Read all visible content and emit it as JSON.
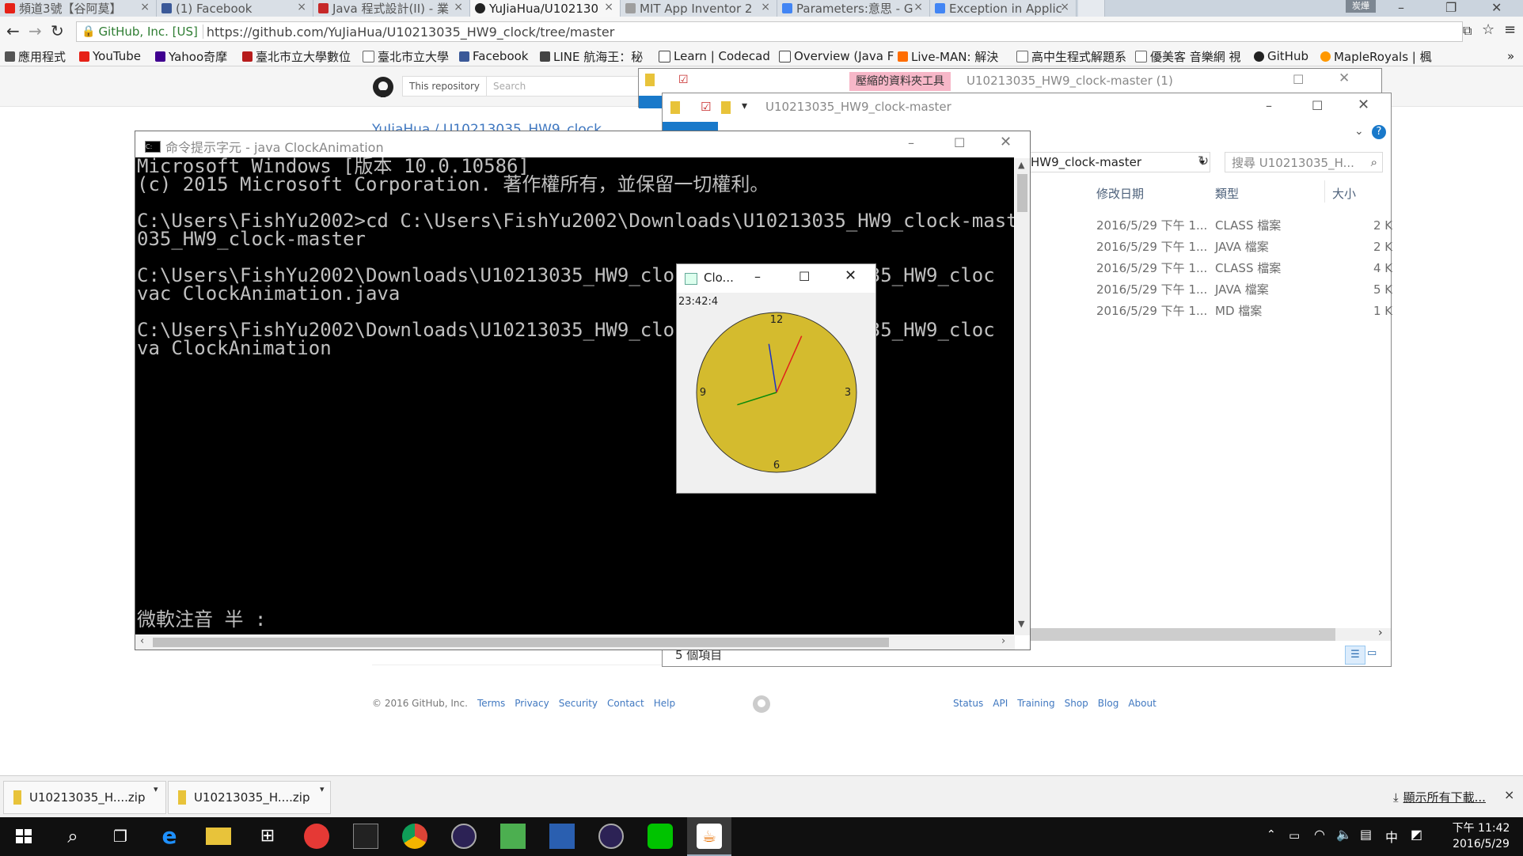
{
  "chrome": {
    "tabs": [
      {
        "label": "頻道3號【谷阿莫】",
        "color": "#e62117"
      },
      {
        "label": "(1) Facebook",
        "color": "#3b5998"
      },
      {
        "label": "Java 程式設計(II) - 業",
        "color": "#c62828"
      },
      {
        "label": "YuJiaHua/U102130",
        "color": "#222222"
      },
      {
        "label": "MIT App Inventor 2",
        "color": "#9e9e9e"
      },
      {
        "label": "Parameters:意思 - G",
        "color": "#4285f4"
      },
      {
        "label": "Exception in Applic",
        "color": "#4285f4"
      }
    ],
    "tab_close": "×",
    "profile": "炭燁",
    "secure_label": "GitHub, Inc. [US]",
    "url": "https://github.com/YuJiaHua/U10213035_HW9_clock/tree/master",
    "bookmarks": [
      {
        "label": "應用程式",
        "color": "#555555"
      },
      {
        "label": "YouTube",
        "color": "#e62117"
      },
      {
        "label": "Yahoo奇摩",
        "color": "#400090"
      },
      {
        "label": "臺北市立大學數位",
        "color": "#b71c1c"
      },
      {
        "label": "臺北市立大學",
        "color": "#666666"
      },
      {
        "label": "Facebook",
        "color": "#3b5998"
      },
      {
        "label": "LINE 航海王：秘",
        "color": "#444444"
      },
      {
        "label": "Learn | Codecad",
        "color": "#444444"
      },
      {
        "label": "Overview (Java F",
        "color": "#444444"
      },
      {
        "label": "Live-MAN: 解決",
        "color": "#ff6d00"
      },
      {
        "label": "高中生程式解題系",
        "color": "#666666"
      },
      {
        "label": "優美客 音樂網 視",
        "color": "#666666"
      },
      {
        "label": "GitHub",
        "color": "#222222"
      },
      {
        "label": "MapleRoyals | 楓",
        "color": "#ff9800"
      }
    ],
    "more": "»"
  },
  "github": {
    "search_scope": "This repository",
    "search_placeholder": "Search",
    "breadcrumb": "YuJiaHua / U10213035_HW9_clock",
    "footer_left": [
      "© 2016 GitHub, Inc.",
      "Terms",
      "Privacy",
      "Security",
      "Contact",
      "Help"
    ],
    "footer_right": [
      "Status",
      "API",
      "Training",
      "Shop",
      "Blog",
      "About"
    ]
  },
  "explorer_back": {
    "title": "U10213035_HW9_clock-master (1)",
    "ribbon_tag": "壓縮的資料夾工具"
  },
  "explorer_front": {
    "title": "U10213035_HW9_clock-master",
    "address": "HW9_clock-master",
    "search_placeholder": "搜尋 U10213035_H...",
    "columns": [
      "修改日期",
      "類型",
      "大小"
    ],
    "rows": [
      {
        "date": "2016/5/29 下午 1...",
        "type": "CLASS 檔案",
        "size": "2 K"
      },
      {
        "date": "2016/5/29 下午 1...",
        "type": "JAVA 檔案",
        "size": "2 K"
      },
      {
        "date": "2016/5/29 下午 1...",
        "type": "CLASS 檔案",
        "size": "4 K"
      },
      {
        "date": "2016/5/29 下午 1...",
        "type": "JAVA 檔案",
        "size": "5 K"
      },
      {
        "date": "2016/5/29 下午 1...",
        "type": "MD 檔案",
        "size": "1 K"
      }
    ],
    "status": "5 個項目"
  },
  "console": {
    "title": "命令提示字元 - java  ClockAnimation",
    "lines": [
      "Microsoft Windows [版本 10.0.10586]",
      "(c) 2015 Microsoft Corporation. 著作權所有，並保留一切權利。",
      "",
      "C:\\Users\\FishYu2002>cd C:\\Users\\FishYu2002\\Downloads\\U10213035_HW9_clock-master",
      "035_HW9_clock-master",
      "",
      "C:\\Users\\FishYu2002\\Downloads\\U10213035_HW9_clock-master\\U10213035_HW9_cloc",
      "vac ClockAnimation.java",
      "",
      "C:\\Users\\FishYu2002\\Downloads\\U10213035_HW9_clock-master\\U10213035_HW9_cloc",
      "va ClockAnimation"
    ],
    "ime": "微軟注音 半 :"
  },
  "clock": {
    "title": "Clo...",
    "time_text": "23:42:4",
    "numbers": {
      "n12": "12",
      "n3": "3",
      "n6": "6",
      "n9": "9"
    },
    "face_color": "#d4bb2e",
    "hands": {
      "hour": 23,
      "minute": 42,
      "second": 4
    },
    "hand_colors": {
      "hour": "#1a33c8",
      "minute": "#0a8a0a",
      "second": "#e0201a"
    }
  },
  "downloads": {
    "items": [
      "U10213035_H....zip",
      "U10213035_H....zip"
    ],
    "show_all": "顯示所有下載...",
    "close": "×"
  },
  "taskbar": {
    "time": "下午 11:42",
    "date": "2016/5/29",
    "ime": "中"
  }
}
